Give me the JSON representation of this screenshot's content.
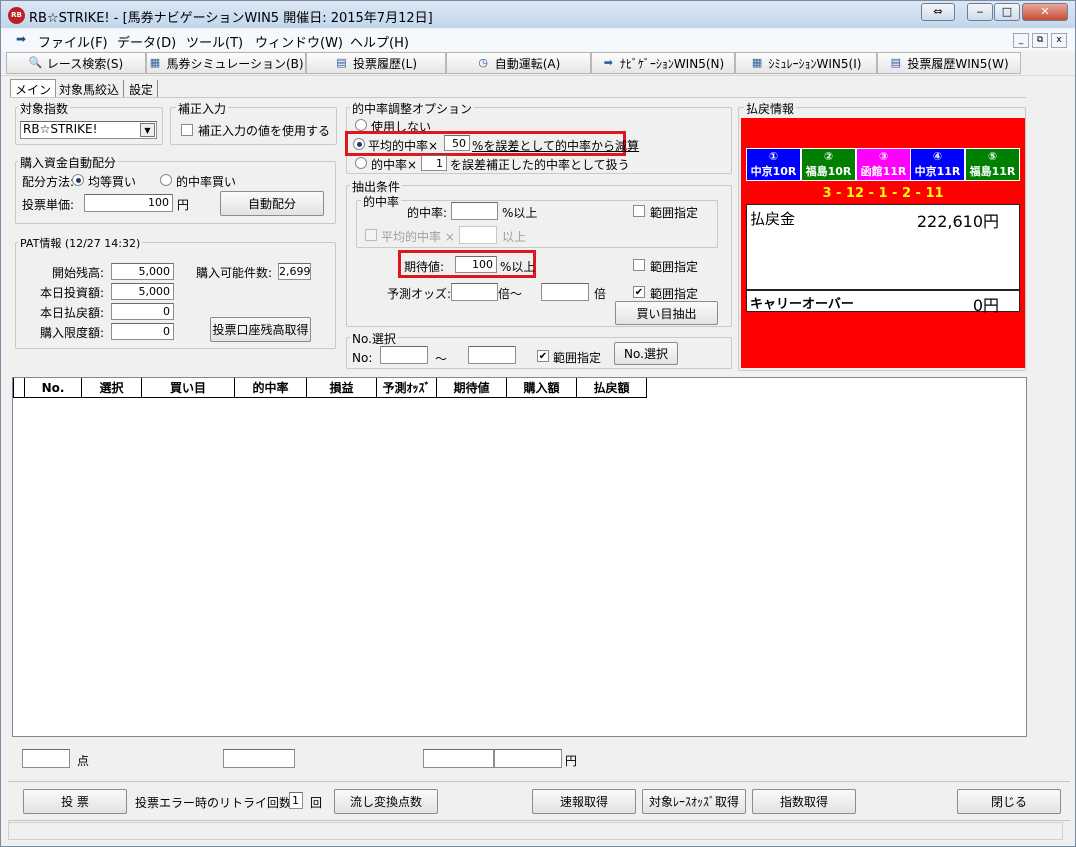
{
  "window": {
    "title": "RB☆STRIKE! - [馬券ナビゲーションWIN5  開催日: 2015年7月12日]",
    "icon_text": "RB",
    "caption_buttons": [
      "⇔",
      "‒",
      "□",
      "✕"
    ]
  },
  "menu": {
    "items": [
      "ファイル(F)",
      "データ(D)",
      "ツール(T)",
      "ウィンドウ(W)",
      "ヘルプ(H)"
    ],
    "mdi_buttons": [
      "_",
      "⧉",
      "x"
    ]
  },
  "toolbar": {
    "buttons": [
      {
        "label": "レース検索(S)",
        "icon": "search-icon"
      },
      {
        "label": "馬券シミュレーション(B)",
        "icon": "grid-icon"
      },
      {
        "label": "投票履歴(L)",
        "icon": "document-icon"
      },
      {
        "label": "自動運転(A)",
        "icon": "clock-icon"
      },
      {
        "label": "ﾅﾋﾞｹﾞｰｼｮﾝWIN5(N)",
        "icon": "arrow-icon"
      },
      {
        "label": "ｼﾐｭﾚｰｼｮﾝWIN5(I)",
        "icon": "grid-icon"
      },
      {
        "label": "投票履歴WIN5(W)",
        "icon": "document-icon"
      }
    ]
  },
  "tabs": [
    "メイン",
    "対象馬絞込",
    "設定"
  ],
  "target": {
    "group_label": "対象指数",
    "selected": "RB☆STRIKE!"
  },
  "correction": {
    "group_label": "補正入力",
    "checkbox_label": "補正入力の値を使用する"
  },
  "auto_alloc": {
    "group_label": "購入資金自動配分",
    "method_label": "配分方法:",
    "option_equal": "均等買い",
    "option_hit": "的中率買い",
    "unit_label": "投票単価:",
    "unit_value": "100",
    "unit_suffix": "円",
    "button": "自動配分"
  },
  "pat": {
    "group_label": "PAT情報 (12/27 14:32)",
    "start_balance_label": "開始残高:",
    "start_balance": "5,000",
    "today_bet_label": "本日投資額:",
    "today_bet": "5,000",
    "today_refund_label": "本日払戻額:",
    "today_refund": "0",
    "limit_label": "購入限度額:",
    "limit": "0",
    "buyable_label": "購入可能件数:",
    "buyable": "2,699",
    "balance_button": "投票口座残高取得"
  },
  "hit_option": {
    "group_label": "的中率調整オプション",
    "opt_none": "使用しない",
    "opt_avg_label": "平均的中率×",
    "opt_avg_value": "50",
    "opt_avg_suffix": "%を誤差として的中率から減算",
    "opt_rate_label": "的中率×",
    "opt_rate_value": "1",
    "opt_rate_suffix": "を誤差補正した的中率として扱う"
  },
  "extract": {
    "group_label": "抽出条件",
    "sub_label": "的中率",
    "hit_rate_label": "的中率:",
    "hit_rate_suffix": "%以上",
    "range_label": "範囲指定",
    "avg_hit_label": "平均的中率 ×",
    "avg_hit_suffix": "以上",
    "ev_label": "期待値:",
    "ev_value": "100",
    "ev_suffix": "%以上",
    "odds_label": "予測オッズ:",
    "odds_mid": "倍〜",
    "odds_suffix": "倍",
    "extract_button": "買い目抽出"
  },
  "no_select": {
    "group_label": "No.選択",
    "no_label": "No:",
    "tilde": "〜",
    "range_label": "範囲指定",
    "button": "No.選択"
  },
  "payout": {
    "group_label": "払戻情報",
    "races": [
      {
        "num": "①",
        "name": "中京10R",
        "color": "#0000ff"
      },
      {
        "num": "②",
        "name": "福島10R",
        "color": "#008000"
      },
      {
        "num": "③",
        "name": "函館11R",
        "color": "#ff00ff"
      },
      {
        "num": "④",
        "name": "中京11R",
        "color": "#0000ff"
      },
      {
        "num": "⑤",
        "name": "福島11R",
        "color": "#008000"
      }
    ],
    "result": "3 - 12 - 1 - 2 - 11",
    "payout_label": "払戻金",
    "payout_value": "222,610円",
    "carry_label": "キャリーオーバー",
    "carry_value": "0円"
  },
  "grid": {
    "columns": [
      "No.",
      "選択",
      "買い目",
      "的中率",
      "損益",
      "予測ｵｯｽﾞ",
      "期待値",
      "購入額",
      "払戻額"
    ]
  },
  "summary": {
    "points_suffix": "点",
    "yen_suffix": "円"
  },
  "footer": {
    "vote_button": "投 票",
    "retry_label": "投票エラー時のリトライ回数:",
    "retry_value": "1",
    "retry_suffix": "回",
    "convert_button": "流し変換点数",
    "flash_button": "速報取得",
    "odds_button": "対象ﾚｰｽｵｯｽﾞ取得",
    "index_button": "指数取得",
    "close_button": "閉じる"
  },
  "colors": {
    "highlight": "#e0161f",
    "payout_bg": "#ff0000",
    "result_text": "#ffff00"
  }
}
